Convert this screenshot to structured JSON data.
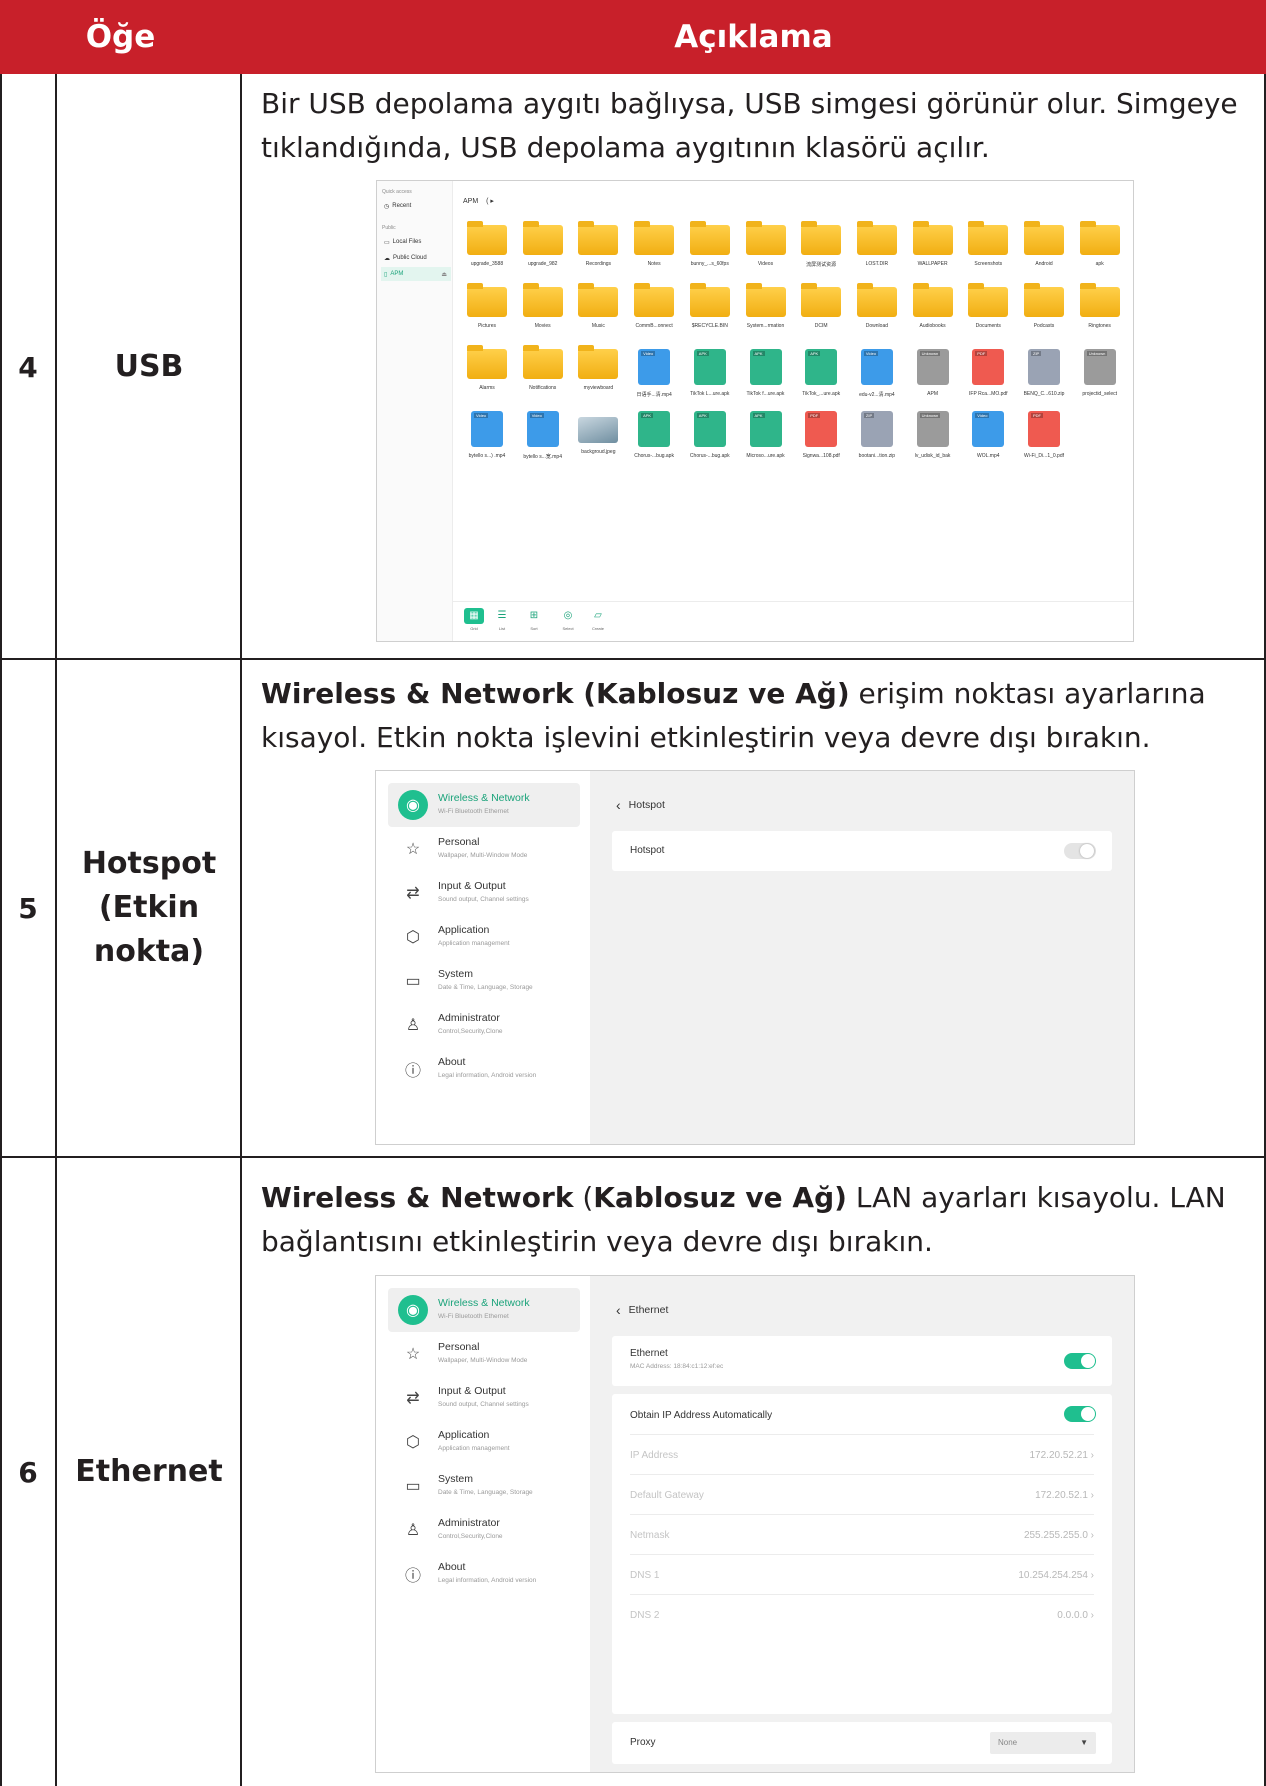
{
  "table": {
    "header": {
      "col_item": "Öğe",
      "col_desc": "Açıklama"
    },
    "rows": [
      {
        "number": "4",
        "item": "USB",
        "desc": "Bir USB depolama aygıtı bağlıysa, USB simgesi görünür olur. Simgeye tıklandığında, USB depolama aygıtının klasörü açılır."
      },
      {
        "number": "5",
        "item": "Hotspot (Etkin nokta)",
        "desc_bold": "Wireless & Network (Kablosuz ve Ağ)",
        "desc_rest": " erişim noktası ayarlarına kısayol. Etkin nokta işlevini etkinleştirin veya devre dışı bırakın."
      },
      {
        "number": "6",
        "item": "Ethernet",
        "desc_bold1": "Wireless & Network",
        "desc_paren": " (",
        "desc_bold2": "Kablosuz ve Ağ)",
        "desc_rest": " LAN ayarları kısayolu. LAN bağlantısını etkinleştirin veya devre dışı bırakın."
      }
    ]
  },
  "file_manager": {
    "quick_access": "Quick access",
    "recent": "Recent",
    "public": "Public",
    "local_files": "Local Files",
    "public_cloud": "Public Cloud",
    "apm": "APM",
    "breadcrumb": "APM",
    "items": [
      {
        "name": "upgrade_3588",
        "kind": "folder"
      },
      {
        "name": "upgrade_982",
        "kind": "folder"
      },
      {
        "name": "Recordings",
        "kind": "folder"
      },
      {
        "name": "Notes",
        "kind": "folder"
      },
      {
        "name": "bunny_...s_60fps",
        "kind": "folder"
      },
      {
        "name": "Videos",
        "kind": "folder"
      },
      {
        "name": "流屏测试资源",
        "kind": "folder"
      },
      {
        "name": "LOST.DIR",
        "kind": "folder"
      },
      {
        "name": "WALLPAPER",
        "kind": "folder"
      },
      {
        "name": "Screenshots",
        "kind": "folder"
      },
      {
        "name": "Android",
        "kind": "folder"
      },
      {
        "name": "apk",
        "kind": "folder"
      },
      {
        "name": "Pictures",
        "kind": "folder"
      },
      {
        "name": "Movies",
        "kind": "folder"
      },
      {
        "name": "Music",
        "kind": "folder"
      },
      {
        "name": "CommB...onnect",
        "kind": "folder"
      },
      {
        "name": "$RECYCLE.BIN",
        "kind": "folder"
      },
      {
        "name": "System...rmation",
        "kind": "folder"
      },
      {
        "name": "DCIM",
        "kind": "folder"
      },
      {
        "name": "Download",
        "kind": "folder"
      },
      {
        "name": "Audiobooks",
        "kind": "folder"
      },
      {
        "name": "Documents",
        "kind": "folder"
      },
      {
        "name": "Podcasts",
        "kind": "folder"
      },
      {
        "name": "Ringtones",
        "kind": "folder"
      },
      {
        "name": "Alarms",
        "kind": "folder"
      },
      {
        "name": "Notifications",
        "kind": "folder"
      },
      {
        "name": "myviewboard",
        "kind": "folder"
      },
      {
        "name": "日语手...清.mp4",
        "kind": "video",
        "tag": "Video"
      },
      {
        "name": "TikTok L...ure.apk",
        "kind": "apk",
        "tag": "APK"
      },
      {
        "name": "TikTok f...ure.apk",
        "kind": "apk",
        "tag": "APK"
      },
      {
        "name": "TikTok_...ure.apk",
        "kind": "apk",
        "tag": "APK"
      },
      {
        "name": "edu-v2...清.mp4",
        "kind": "video",
        "tag": "Video"
      },
      {
        "name": "APM",
        "kind": "unknown",
        "tag": "Unknown"
      },
      {
        "name": "IFP Rca...MO.pdf",
        "kind": "pdf",
        "tag": "PDF"
      },
      {
        "name": "BENQ_C...610.zip",
        "kind": "zip",
        "tag": "ZIP"
      },
      {
        "name": "projectid_select",
        "kind": "unknown",
        "tag": "Unknown"
      },
      {
        "name": "bytello s...) .mp4",
        "kind": "video",
        "tag": "Video"
      },
      {
        "name": "bytello s...宽.mp4",
        "kind": "video",
        "tag": "Video"
      },
      {
        "name": "backgroud.jpeg",
        "kind": "image"
      },
      {
        "name": "Chorus-...bug.apk",
        "kind": "apk",
        "tag": "APK"
      },
      {
        "name": "Chorus-...bug.apk",
        "kind": "apk",
        "tag": "APK"
      },
      {
        "name": "Microso...ure.apk",
        "kind": "apk",
        "tag": "APK"
      },
      {
        "name": "Signwa...108.pdf",
        "kind": "pdf",
        "tag": "PDF"
      },
      {
        "name": "bootani...tion.zip",
        "kind": "zip",
        "tag": "ZIP"
      },
      {
        "name": "lv_udisk_id_bak",
        "kind": "unknown",
        "tag": "Unknown"
      },
      {
        "name": "WOL.mp4",
        "kind": "video",
        "tag": "Video"
      },
      {
        "name": "Wi-Fi_Di...1_0.pdf",
        "kind": "pdf",
        "tag": "PDF"
      }
    ],
    "toolbar": {
      "grid": "Grid",
      "list": "List",
      "sort": "Sort",
      "select": "Select",
      "create": "Create"
    }
  },
  "settings_menu": [
    {
      "title": "Wireless & Network",
      "sub": "Wi-Fi Bluetooth Ethernet",
      "icon": "wifi-icon"
    },
    {
      "title": "Personal",
      "sub": "Wallpaper, Multi-Window Mode",
      "icon": "star-icon"
    },
    {
      "title": "Input & Output",
      "sub": "Sound output, Channel settings",
      "icon": "swap-arrows-icon"
    },
    {
      "title": "Application",
      "sub": "Application management",
      "icon": "cube-icon"
    },
    {
      "title": "System",
      "sub": "Date & Time, Language, Storage",
      "icon": "presentation-icon"
    },
    {
      "title": "Administrator",
      "sub": "Control,Security,Clone",
      "icon": "person-icon"
    },
    {
      "title": "About",
      "sub": "Legal information, Android version",
      "icon": "info-icon"
    }
  ],
  "hotspot": {
    "back_title": "Hotspot",
    "row_label": "Hotspot",
    "enabled": false
  },
  "ethernet": {
    "back_title": "Ethernet",
    "ethernet_label": "Ethernet",
    "mac": "MAC Address: 18:84:c1:12:ef:ec",
    "ethernet_enabled": true,
    "obtain_ip_label": "Obtain IP Address Automatically",
    "obtain_ip_enabled": true,
    "fields": [
      {
        "label": "IP Address",
        "value": "172.20.52.21"
      },
      {
        "label": "Default Gateway",
        "value": "172.20.52.1"
      },
      {
        "label": "Netmask",
        "value": "255.255.255.0"
      },
      {
        "label": "DNS 1",
        "value": "10.254.254.254"
      },
      {
        "label": "DNS 2",
        "value": "0.0.0.0"
      }
    ],
    "proxy_label": "Proxy",
    "proxy_value": "None"
  },
  "colors": {
    "header_red": "#c8202a",
    "accent_green": "#1fbf8f"
  }
}
